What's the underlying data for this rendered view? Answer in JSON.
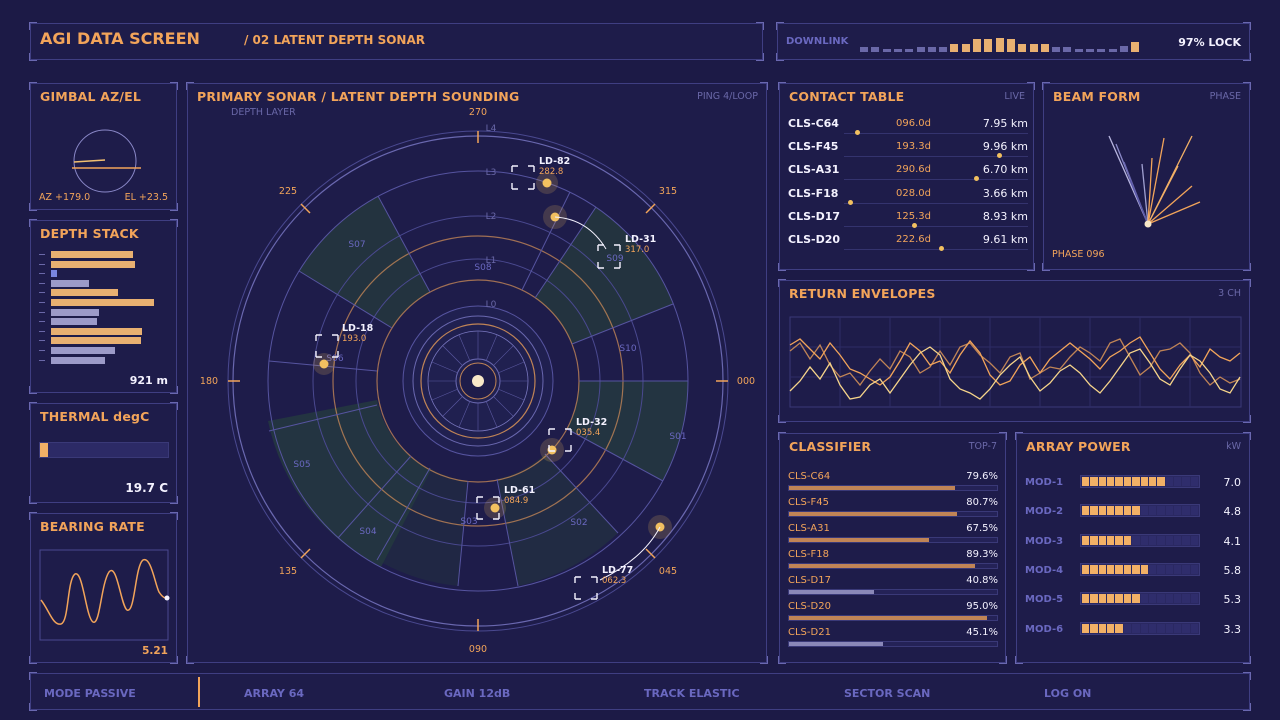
{
  "header": {
    "title": "AGI DATA SCREEN",
    "subtitle": "/ 02 LATENT DEPTH SONAR"
  },
  "downlink": {
    "label": "DOWNLINK",
    "lock": "97% LOCK",
    "bars": [
      0.3,
      0.3,
      0.2,
      0.2,
      0.2,
      0.3,
      0.3,
      0.3,
      0.5,
      0.5,
      0.8,
      0.8,
      0.9,
      0.8,
      0.5,
      0.5,
      0.5,
      0.3,
      0.3,
      0.2,
      0.2,
      0.2,
      0.2,
      0.4,
      0.6
    ]
  },
  "gimbal": {
    "title": "GIMBAL AZ/EL",
    "az": "AZ +179.0",
    "el": "EL +23.5"
  },
  "depth_stack": {
    "title": "DEPTH STACK",
    "value": "921 m",
    "bars": [
      {
        "w": 0.8,
        "c": "orange"
      },
      {
        "w": 0.82,
        "c": "orange"
      },
      {
        "w": 0.06,
        "c": "blue"
      },
      {
        "w": 0.37,
        "c": "lavender"
      },
      {
        "w": 0.65,
        "c": "orange"
      },
      {
        "w": 1.0,
        "c": "orange"
      },
      {
        "w": 0.47,
        "c": "lavender"
      },
      {
        "w": 0.45,
        "c": "lavender"
      },
      {
        "w": 0.88,
        "c": "orange"
      },
      {
        "w": 0.87,
        "c": "orange"
      },
      {
        "w": 0.62,
        "c": "lavender"
      },
      {
        "w": 0.52,
        "c": "lavender"
      }
    ]
  },
  "thermal": {
    "title": "THERMAL degC",
    "value": "19.7 C",
    "level": 0.06
  },
  "bearing_rate": {
    "title": "BEARING RATE",
    "value": "5.21"
  },
  "sonar": {
    "title": "PRIMARY SONAR / LATENT DEPTH SOUNDING",
    "tag": "PING 4/LOOP",
    "depth_layer": "DEPTH LAYER",
    "bearings": {
      "b270": "270",
      "b315": "315",
      "b000": "000",
      "b045": "045",
      "b090": "090",
      "b135": "135",
      "b180": "180",
      "b225": "225"
    },
    "layers": [
      "L0",
      "L1",
      "L2",
      "L3",
      "L4"
    ],
    "sectors": [
      "S01",
      "S02",
      "S03",
      "S04",
      "S05",
      "S07",
      "S08",
      "S09",
      "S10"
    ],
    "contacts": [
      {
        "id": "LD-82",
        "brg": "282.8"
      },
      {
        "id": "LD-31",
        "brg": "317.0"
      },
      {
        "id": "LD-18",
        "brg": "193.0"
      },
      {
        "id": "LD-32",
        "brg": "035.4"
      },
      {
        "id": "LD-61",
        "brg": "084.9"
      },
      {
        "id": "LD-77",
        "brg": "062.3"
      }
    ],
    "s6_label": "S06"
  },
  "contact_table": {
    "title": "CONTACT TABLE",
    "tag": "LIVE",
    "rows": [
      {
        "id": "CLS-C64",
        "brg": "096.0d",
        "rng": "7.95 km",
        "dot": 0.06
      },
      {
        "id": "CLS-F45",
        "brg": "193.3d",
        "rng": "9.96 km",
        "dot": 0.85
      },
      {
        "id": "CLS-A31",
        "brg": "290.6d",
        "rng": "6.70 km",
        "dot": 0.72
      },
      {
        "id": "CLS-F18",
        "brg": "028.0d",
        "rng": "3.66 km",
        "dot": 0.02
      },
      {
        "id": "CLS-D17",
        "brg": "125.3d",
        "rng": "8.93 km",
        "dot": 0.38
      },
      {
        "id": "CLS-D20",
        "brg": "222.6d",
        "rng": "9.61 km",
        "dot": 0.53
      }
    ]
  },
  "beam_form": {
    "title": "BEAM FORM",
    "tag": "PHASE",
    "phase": "PHASE 096"
  },
  "return_envelopes": {
    "title": "RETURN ENVELOPES",
    "tag": "3 CH"
  },
  "classifier": {
    "title": "CLASSIFIER",
    "tag": "TOP-7",
    "rows": [
      {
        "name": "CLS-C64",
        "pct": "79.6%",
        "value": 0.796
      },
      {
        "name": "CLS-F45",
        "pct": "80.7%",
        "value": 0.807
      },
      {
        "name": "CLS-A31",
        "pct": "67.5%",
        "value": 0.675
      },
      {
        "name": "CLS-F18",
        "pct": "89.3%",
        "value": 0.893
      },
      {
        "name": "CLS-D17",
        "pct": "40.8%",
        "value": 0.408
      },
      {
        "name": "CLS-D20",
        "pct": "95.0%",
        "value": 0.95
      },
      {
        "name": "CLS-D21",
        "pct": "45.1%",
        "value": 0.451
      }
    ]
  },
  "array_power": {
    "title": "ARRAY POWER",
    "unit": "kW",
    "rows": [
      {
        "name": "MOD-1",
        "value": "7.0",
        "level": 0.7
      },
      {
        "name": "MOD-2",
        "value": "4.8",
        "level": 0.5
      },
      {
        "name": "MOD-3",
        "value": "4.1",
        "level": 0.43
      },
      {
        "name": "MOD-4",
        "value": "5.8",
        "level": 0.57
      },
      {
        "name": "MOD-5",
        "value": "5.3",
        "level": 0.5
      },
      {
        "name": "MOD-6",
        "value": "3.3",
        "level": 0.36
      }
    ]
  },
  "status_bar": {
    "mode": "MODE PASSIVE",
    "array": "ARRAY 64",
    "gain": "GAIN 12dB",
    "track": "TRACK ELASTIC",
    "sector": "SECTOR SCAN",
    "log": "LOG ON"
  },
  "colors": {
    "background": "#1c1a46",
    "accent": "#f2a45a",
    "panel_border": "#3f3e82",
    "text_white": "#f4f2ff",
    "muted": "#6a68a8"
  }
}
